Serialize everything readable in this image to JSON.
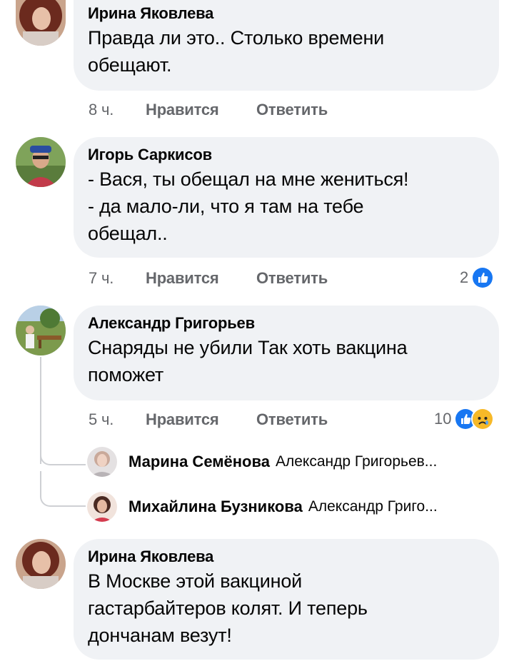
{
  "comments": [
    {
      "author": "Ирина Яковлева",
      "lines": [
        "Правда ли это.. Столько времени",
        "обещают."
      ],
      "time": "8 ч.",
      "like": "Нравится",
      "reply": "Ответить"
    },
    {
      "author": "Игорь Саркисов",
      "lines": [
        "- Вася, ты обещал на мне жениться!",
        "- да мало-ли, что я там на тебе",
        "обещал.."
      ],
      "time": "7 ч.",
      "like": "Нравится",
      "reply": "Ответить",
      "reaction_count": "2",
      "reactions": [
        "like-icon"
      ]
    },
    {
      "author": "Александр Григорьев",
      "lines": [
        "Снаряды не убили Так хоть вакцина",
        "поможет"
      ],
      "time": "5 ч.",
      "like": "Нравится",
      "reply": "Ответить",
      "reaction_count": "10",
      "reactions": [
        "like-icon",
        "sad-icon"
      ],
      "replies": [
        {
          "author": "Марина Семёнова",
          "snippet": "Александр Григорьев..."
        },
        {
          "author": "Михайлина Бузникова",
          "snippet": "Александр Григо..."
        }
      ]
    },
    {
      "author": "Ирина Яковлева",
      "lines": [
        "В Москве этой вакциной",
        "гастарбайтеров колят. И теперь",
        "дончанам везут!"
      ]
    }
  ],
  "colors": {
    "bubble": "#f0f2f5",
    "meta_text": "#65676b",
    "like_blue": "#1877f2",
    "sad_yellow": "#f7b928"
  }
}
